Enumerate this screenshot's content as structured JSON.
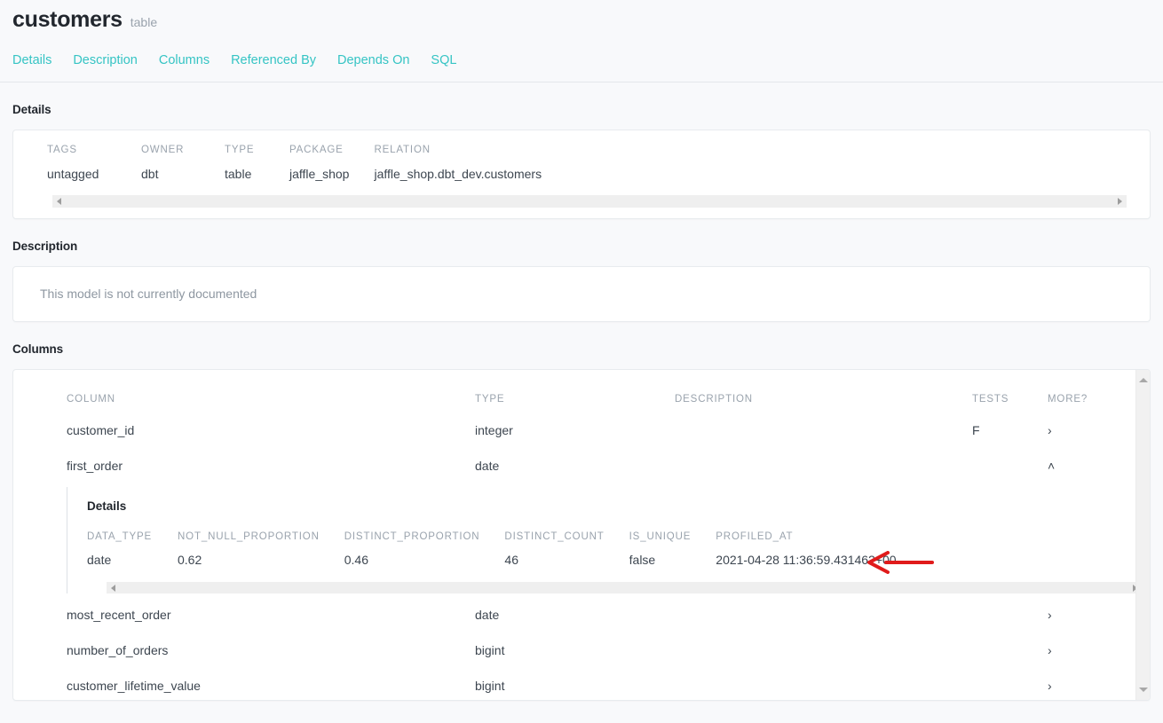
{
  "header": {
    "title": "customers",
    "subtitle": "table",
    "tabs": [
      {
        "label": "Details"
      },
      {
        "label": "Description"
      },
      {
        "label": "Columns"
      },
      {
        "label": "Referenced By"
      },
      {
        "label": "Depends On"
      },
      {
        "label": "SQL"
      }
    ],
    "accent_color": "#35c4c4"
  },
  "details": {
    "section_title": "Details",
    "fields": [
      {
        "label": "TAGS",
        "value": "untagged"
      },
      {
        "label": "OWNER",
        "value": "dbt"
      },
      {
        "label": "TYPE",
        "value": "table"
      },
      {
        "label": "PACKAGE",
        "value": "jaffle_shop"
      },
      {
        "label": "RELATION",
        "value": "jaffle_shop.dbt_dev.customers"
      }
    ]
  },
  "description": {
    "section_title": "Description",
    "text": "This model is not currently documented"
  },
  "columns": {
    "section_title": "Columns",
    "headers": {
      "name": "COLUMN",
      "type": "TYPE",
      "description": "DESCRIPTION",
      "tests": "TESTS",
      "more": "MORE?"
    },
    "rows": [
      {
        "name": "customer_id",
        "type": "integer",
        "description": "",
        "tests": "F",
        "more": "›",
        "expanded": false
      },
      {
        "name": "first_order",
        "type": "date",
        "description": "",
        "tests": "",
        "more": "˄",
        "expanded": true
      },
      {
        "name": "most_recent_order",
        "type": "date",
        "description": "",
        "tests": "",
        "more": "›",
        "expanded": false
      },
      {
        "name": "number_of_orders",
        "type": "bigint",
        "description": "",
        "tests": "",
        "more": "›",
        "expanded": false
      },
      {
        "name": "customer_lifetime_value",
        "type": "bigint",
        "description": "",
        "tests": "",
        "more": "›",
        "expanded": false
      }
    ],
    "expanded_detail": {
      "title": "Details",
      "fields": [
        {
          "label": "DATA_TYPE",
          "value": "date"
        },
        {
          "label": "NOT_NULL_PROPORTION",
          "value": "0.62"
        },
        {
          "label": "DISTINCT_PROPORTION",
          "value": "0.46"
        },
        {
          "label": "DISTINCT_COUNT",
          "value": "46"
        },
        {
          "label": "IS_UNIQUE",
          "value": "false"
        },
        {
          "label": "PROFILED_AT",
          "value": "2021-04-28 11:36:59.431462+00"
        }
      ]
    }
  },
  "annotation": {
    "type": "left-arrow",
    "color": "#e01b1b"
  }
}
